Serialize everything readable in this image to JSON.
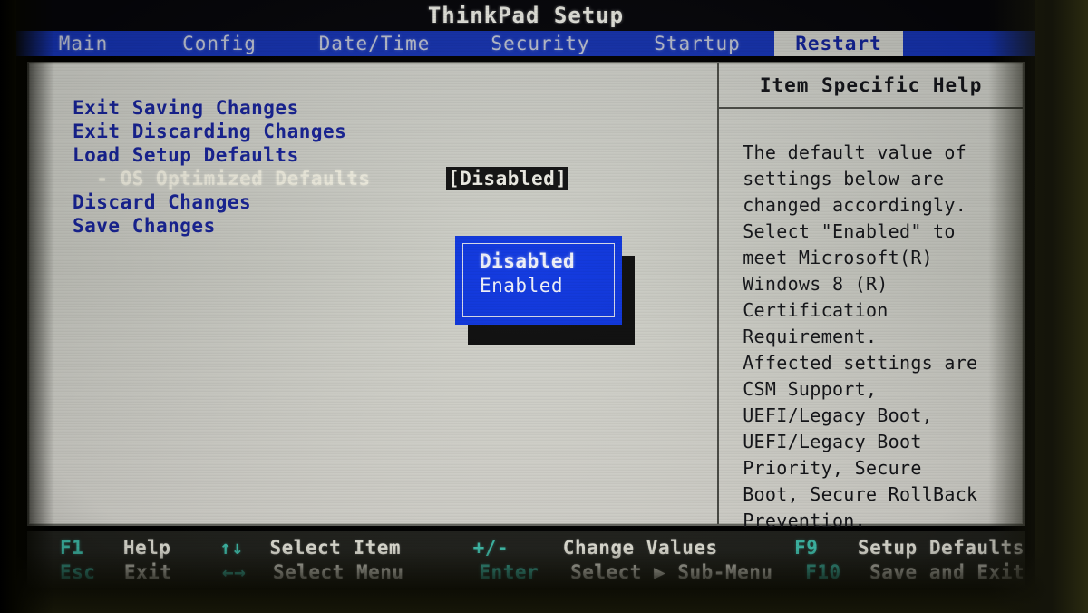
{
  "window": {
    "title": "ThinkPad Setup"
  },
  "tabs": [
    {
      "label": "Main",
      "active": false
    },
    {
      "label": "Config",
      "active": false
    },
    {
      "label": "Date/Time",
      "active": false
    },
    {
      "label": "Security",
      "active": false
    },
    {
      "label": "Startup",
      "active": false
    },
    {
      "label": "Restart",
      "active": true
    }
  ],
  "menu": {
    "items": [
      {
        "label": "Exit Saving Changes",
        "selected": false,
        "value": null
      },
      {
        "label": "Exit Discarding Changes",
        "selected": false,
        "value": null
      },
      {
        "label": "Load Setup Defaults",
        "selected": false,
        "value": null
      },
      {
        "label": "  - OS Optimized Defaults",
        "selected": true,
        "value": "[Disabled]"
      },
      {
        "label": "Discard Changes",
        "selected": false,
        "value": null
      },
      {
        "label": "Save Changes",
        "selected": false,
        "value": null
      }
    ]
  },
  "popup": {
    "options": [
      {
        "label": "Disabled",
        "selected": true
      },
      {
        "label": "Enabled",
        "selected": false
      }
    ]
  },
  "help": {
    "title": "Item Specific Help",
    "lines": [
      "The default value of",
      "settings below are",
      "changed accordingly.",
      "Select \"Enabled\" to",
      "meet Microsoft(R)",
      "Windows 8 (R)",
      "Certification",
      "Requirement.",
      "Affected settings are",
      "CSM Support,",
      "UEFI/Legacy Boot,",
      "UEFI/Legacy Boot",
      "Priority, Secure",
      "Boot, Secure RollBack",
      "Prevention."
    ]
  },
  "footer": {
    "row1": {
      "k1": "F1",
      "d1": "Help",
      "k2": "↑↓",
      "d2": "Select Item",
      "k3": "+/-",
      "d3": "Change Values",
      "k4": "F9",
      "d4": "Setup Defaults"
    },
    "row2": {
      "k1": "Esc",
      "d1": "Exit",
      "k2": "←→",
      "d2": "Select Menu",
      "k3": "Enter",
      "d3": "Select ▶ Sub-Menu",
      "k4": "F10",
      "d4": "Save and Exit"
    }
  },
  "colors": {
    "tabbar_blue": "#1634b4",
    "menu_blue": "#17239b",
    "popup_blue": "#0b34e0",
    "footer_key_teal": "#43c8b4",
    "panel_gray": "#cdcec6"
  }
}
